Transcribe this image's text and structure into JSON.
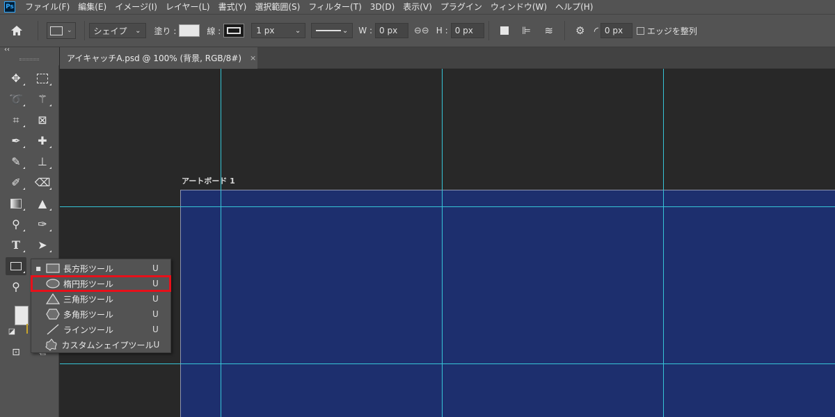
{
  "app": {
    "logo_text": "Ps"
  },
  "menubar": {
    "items": [
      "ファイル(F)",
      "編集(E)",
      "イメージ(I)",
      "レイヤー(L)",
      "書式(Y)",
      "選択範囲(S)",
      "フィルター(T)",
      "3D(D)",
      "表示(V)",
      "プラグイン",
      "ウィンドウ(W)",
      "ヘルプ(H)"
    ]
  },
  "options": {
    "shape_type": "シェイプ",
    "fill_label": "塗り :",
    "stroke_label": "線 :",
    "stroke_width": "1 px",
    "w_label": "W :",
    "w_value": "0 px",
    "h_label": "H :",
    "h_value": "0 px",
    "radius_value": "0 px",
    "align_edges_label": "エッジを整列"
  },
  "document": {
    "tab_title": "アイキャッチA.psd @ 100% (背景, RGB/8#)",
    "close_glyph": "×",
    "artboard_label": "アートボード 1"
  },
  "flyout": {
    "items": [
      {
        "label": "長方形ツール",
        "key": "U",
        "selected": true,
        "icon": "rectangle-icon"
      },
      {
        "label": "楕円形ツール",
        "key": "U",
        "selected": false,
        "icon": "ellipse-icon",
        "highlighted": true
      },
      {
        "label": "三角形ツール",
        "key": "U",
        "selected": false,
        "icon": "triangle-icon"
      },
      {
        "label": "多角形ツール",
        "key": "U",
        "selected": false,
        "icon": "polygon-icon"
      },
      {
        "label": "ラインツール",
        "key": "U",
        "selected": false,
        "icon": "line-icon"
      },
      {
        "label": "カスタムシェイプツール",
        "key": "U",
        "selected": false,
        "icon": "custom-shape-icon"
      }
    ]
  },
  "colors": {
    "artboard_fill": "#1d2f6e",
    "guide": "#36c6d8",
    "highlight_outline": "#e8101a"
  }
}
